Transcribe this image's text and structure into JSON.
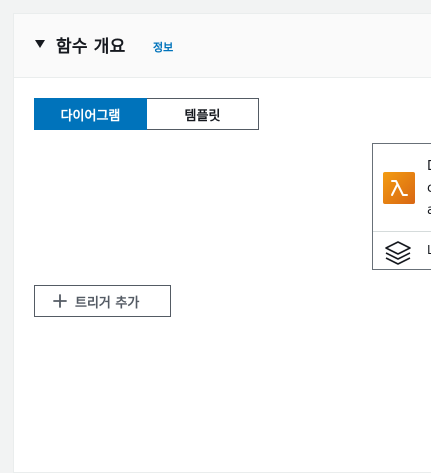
{
  "panel": {
    "title": "함수 개요",
    "info_link": "정보"
  },
  "view_toggle": {
    "options": [
      {
        "label": "다이어그램",
        "selected": true
      },
      {
        "label": "템플릿",
        "selected": false
      }
    ]
  },
  "function_card": {
    "icon": "lambda-icon",
    "lines": [
      "D",
      "c",
      "a"
    ],
    "layers_icon": "layers-icon",
    "layers_label": "L"
  },
  "add_trigger": {
    "icon": "plus-icon",
    "label": "트리거 추가"
  },
  "colors": {
    "accent": "#0073bb",
    "lambda_orange": "#d86613",
    "border": "#545b64",
    "background": "#f2f3f3"
  }
}
